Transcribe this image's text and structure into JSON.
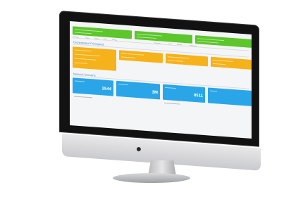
{
  "screen": {
    "section_primary_title": "Orchestrated Pricingsets",
    "section_secondary_title": "Network Domains",
    "stat_values": [
      "2544",
      "3M",
      "8511"
    ]
  },
  "colors": {
    "green": "#5cc62b",
    "amber": "#f6b21a",
    "blue": "#2aa6e8",
    "title_blue": "#4a90c8"
  }
}
